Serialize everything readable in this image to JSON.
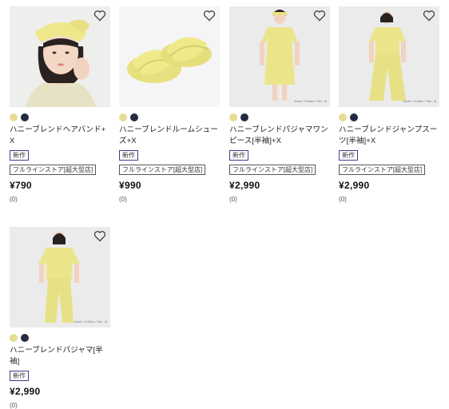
{
  "colors": {
    "swatch_yellow": "#e6dc94",
    "swatch_navy": "#262b45",
    "badge_border": "#3d3d8f",
    "product_yellow": "#eeea90"
  },
  "products": [
    {
      "name": "ハニーブレンドヘアバンド+X",
      "badge": "新作",
      "store": "フルラインストア[超大型店]",
      "price": "¥790",
      "reviews": "(0)",
      "swatches": [
        "yellow",
        "navy"
      ]
    },
    {
      "name": "ハニーブレンドルームシューズ+X",
      "badge": "新作",
      "store": "フルラインストア[超大型店]",
      "price": "¥990",
      "reviews": "(0)",
      "swatches": [
        "yellow",
        "navy"
      ]
    },
    {
      "name": "ハニーブレンドパジャマワンピース[半袖]+X",
      "badge": "新作",
      "store": "フルラインストア[超大型店]",
      "price": "¥2,990",
      "reviews": "(0)",
      "swatches": [
        "yellow",
        "navy"
      ],
      "model_note": "Model : H168cm / Size : M"
    },
    {
      "name": "ハニーブレンドジャンプスーツ[半袖]+X",
      "badge": "新作",
      "store": "フルラインストア[超大型店]",
      "price": "¥2,990",
      "reviews": "(0)",
      "swatches": [
        "yellow",
        "navy"
      ],
      "model_note": "Model : H168cm / Size : M"
    },
    {
      "name": "ハニーブレンドパジャマ[半袖]",
      "badge": "新作",
      "price": "¥2,990",
      "reviews": "(0)",
      "swatches": [
        "yellow",
        "navy"
      ],
      "model_note": "Model : H168cm / Size : M"
    }
  ]
}
